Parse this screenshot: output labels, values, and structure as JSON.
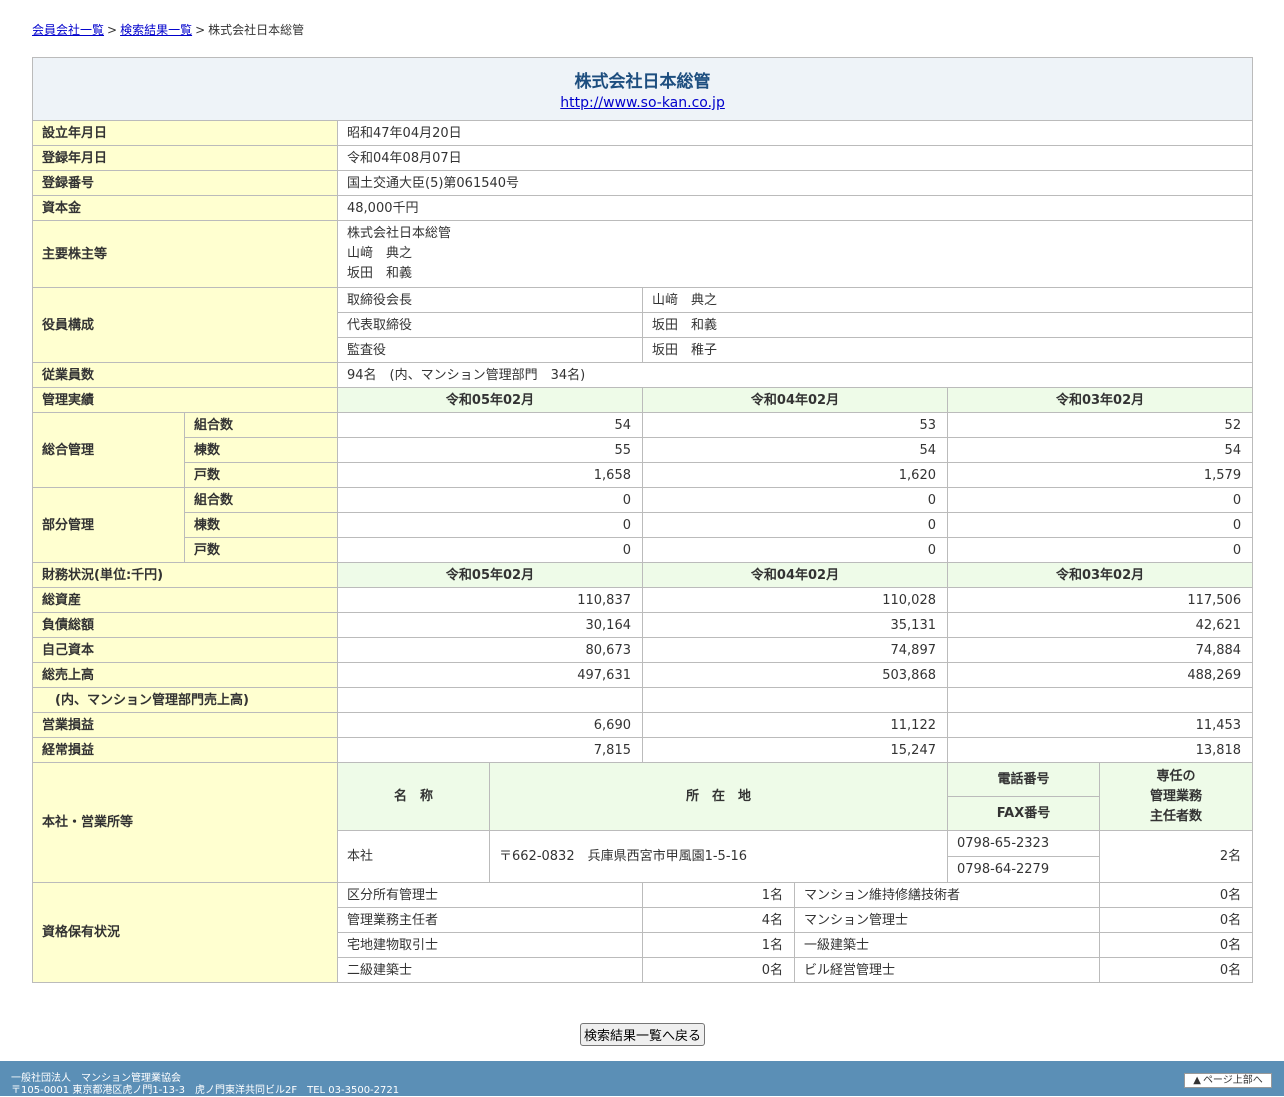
{
  "breadcrumb": {
    "link1": "会員会社一覧",
    "link2": "検索結果一覧",
    "current": "株式会社日本総管",
    "sep": ">"
  },
  "company": {
    "name": "株式会社日本総管",
    "url": "http://www.so-kan.co.jp"
  },
  "basic": {
    "established_label": "設立年月日",
    "established": "昭和47年04月20日",
    "registered_label": "登録年月日",
    "registered": "令和04年08月07日",
    "regno_label": "登録番号",
    "regno": "国土交通大臣(5)第061540号",
    "capital_label": "資本金",
    "capital": "48,000千円",
    "shareholders_label": "主要株主等",
    "shareholders": [
      "株式会社日本総管",
      "山﨑　典之",
      "坂田　和義"
    ],
    "officers_label": "役員構成",
    "officers": [
      {
        "title": "取締役会長",
        "name": "山﨑　典之"
      },
      {
        "title": "代表取締役",
        "name": "坂田　和義"
      },
      {
        "title": "監査役",
        "name": "坂田　稚子"
      }
    ],
    "employees_label": "従業員数",
    "employees": "94名　(内、マンション管理部門　34名)"
  },
  "mgmt": {
    "label": "管理実績",
    "periods": [
      "令和05年02月",
      "令和04年02月",
      "令和03年02月"
    ],
    "general_label": "総合管理",
    "partial_label": "部分管理",
    "row_labels": [
      "組合数",
      "棟数",
      "戸数"
    ],
    "general": [
      [
        "54",
        "53",
        "52"
      ],
      [
        "55",
        "54",
        "54"
      ],
      [
        "1,658",
        "1,620",
        "1,579"
      ]
    ],
    "partial": [
      [
        "0",
        "0",
        "0"
      ],
      [
        "0",
        "0",
        "0"
      ],
      [
        "0",
        "0",
        "0"
      ]
    ]
  },
  "finance": {
    "label": "財務状況(単位:千円)",
    "periods": [
      "令和05年02月",
      "令和04年02月",
      "令和03年02月"
    ],
    "rows": [
      {
        "label": "総資産",
        "values": [
          "110,837",
          "110,028",
          "117,506"
        ]
      },
      {
        "label": "負債総額",
        "values": [
          "30,164",
          "35,131",
          "42,621"
        ]
      },
      {
        "label": "自己資本",
        "values": [
          "80,673",
          "74,897",
          "74,884"
        ]
      },
      {
        "label": "総売上高",
        "values": [
          "497,631",
          "503,868",
          "488,269"
        ]
      },
      {
        "label": "(内、マンション管理部門売上高)",
        "values": [
          "",
          "",
          ""
        ]
      },
      {
        "label": "営業損益",
        "values": [
          "6,690",
          "11,122",
          "11,453"
        ]
      },
      {
        "label": "経常損益",
        "values": [
          "7,815",
          "15,247",
          "13,818"
        ]
      }
    ]
  },
  "offices": {
    "label": "本社・営業所等",
    "col_name": "名　称",
    "col_address": "所　在　地",
    "col_tel": "電話番号",
    "col_fax": "FAX番号",
    "col_staff_1": "専任の",
    "col_staff_2": "管理業務",
    "col_staff_3": "主任者数",
    "rows": [
      {
        "name": "本社",
        "address": "〒662-0832　兵庫県西宮市甲風園1-5-16",
        "tel": "0798-65-2323",
        "fax": "0798-64-2279",
        "staff": "2名"
      }
    ]
  },
  "quals": {
    "label": "資格保有状況",
    "rows": [
      {
        "a": "区分所有管理士",
        "av": "1名",
        "b": "マンション維持修繕技術者",
        "bv": "0名"
      },
      {
        "a": "管理業務主任者",
        "av": "4名",
        "b": "マンション管理士",
        "bv": "0名"
      },
      {
        "a": "宅地建物取引士",
        "av": "1名",
        "b": "一級建築士",
        "bv": "0名"
      },
      {
        "a": "二級建築士",
        "av": "0名",
        "b": "ビル経営管理士",
        "bv": "0名"
      }
    ]
  },
  "back_button": "検索結果一覧へ戻る",
  "footer": {
    "org": "一般社団法人　マンション管理業協会",
    "addr": "〒105-0001 東京都港区虎ノ門1-13-3　虎ノ門東洋共同ビル2F　TEL 03-3500-2721",
    "pagetop": "ページ上部へ"
  },
  "colors": {
    "label_bg": "#ffffd0",
    "period_bg": "#eefbe8",
    "header_bg": "#eef3f8",
    "footer_bg": "#5b8fb6",
    "title": "#1d4e7f"
  }
}
